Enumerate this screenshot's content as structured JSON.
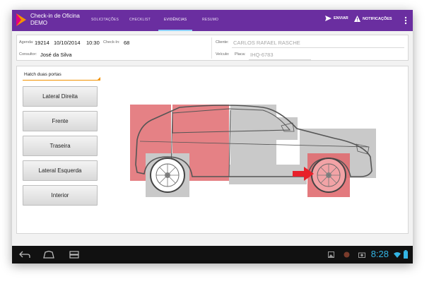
{
  "app": {
    "title_line1": "Check-in de Oficina",
    "title_line2": "DEMO",
    "tabs": [
      {
        "label": "SOLICITAÇÕES",
        "active": false
      },
      {
        "label": "CHECKLIST",
        "active": false
      },
      {
        "label": "EVIDÊNCIAS",
        "active": true
      },
      {
        "label": "RESUMO",
        "active": false
      }
    ],
    "actions": {
      "send_label": "ENVIAR",
      "notifications_label": "NOTIFICAÇÕES"
    },
    "colors": {
      "bar": "#6a2ea0",
      "tab_indicator": "#8fd3ff",
      "damage": "#e06b70",
      "arrow": "#e8202a",
      "clock": "#33b5e5"
    }
  },
  "info": {
    "agenda_label": "Agenda:",
    "agenda_value": "19214",
    "date_value": "10/10/2014",
    "time_value": "10:30",
    "checkin_label": "Check-In:",
    "checkin_value": "68",
    "consultor_label": "Consultor:",
    "consultor_value": "José da Silva",
    "cliente_label": "Cliente:",
    "cliente_value": "CARLOS RAFAEL RASCHE",
    "veiculo_label": "Veículo:",
    "placa_label": "Placa:",
    "placa_value": "IHQ-6783"
  },
  "main": {
    "vehicle_type": "Hatch duas portas",
    "buttons": [
      "Lateral Direita",
      "Frente",
      "Traseira",
      "Lateral Esquerda",
      "Interior"
    ],
    "selected_view": "Lateral Direita",
    "damaged_regions": [
      "rear-quarter",
      "door",
      "rear-wheel",
      "front-wheel"
    ]
  },
  "system": {
    "clock": "8:28",
    "nav_icons": [
      "back-icon",
      "home-icon",
      "recent-apps-icon"
    ],
    "status_icons": [
      "gallery-icon",
      "app-icon",
      "camera-icon",
      "wifi-icon",
      "battery-icon"
    ]
  }
}
